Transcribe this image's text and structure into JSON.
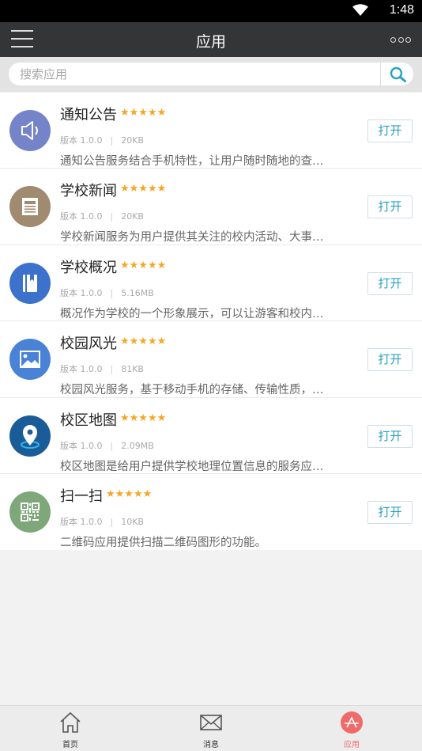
{
  "status_bar": {
    "time": "1:48",
    "wifi_icon": "wifi-icon"
  },
  "app_bar": {
    "title": "应用",
    "menu_icon": "hamburger-menu-icon",
    "more_icon": "more-dots-icon"
  },
  "search": {
    "placeholder": "搜索应用",
    "value": "",
    "icon": "search-icon"
  },
  "apps": [
    {
      "name": "通知公告",
      "rating": 5,
      "version": "版本 1.0.0",
      "size": "20KB",
      "description": "通知公告服务结合手机特性，让用户随时随地的查…",
      "action": "打开",
      "icon": "speaker-icon",
      "icon_color": "#7584c9"
    },
    {
      "name": "学校新闻",
      "rating": 5,
      "version": "版本 1.0.0",
      "size": "20KB",
      "description": "学校新闻服务为用户提供其关注的校内活动、大事…",
      "action": "打开",
      "icon": "newspaper-icon",
      "icon_color": "#a08a70"
    },
    {
      "name": "学校概况",
      "rating": 5,
      "version": "版本 1.0.0",
      "size": "5.16MB",
      "description": "概况作为学校的一个形象展示，可以让游客和校内…",
      "action": "打开",
      "icon": "book-icon",
      "icon_color": "#3c72cc"
    },
    {
      "name": "校园风光",
      "rating": 5,
      "version": "版本 1.0.0",
      "size": "81KB",
      "description": "校园风光服务，基于移动手机的存储、传输性质，…",
      "action": "打开",
      "icon": "picture-icon",
      "icon_color": "#4a82d6"
    },
    {
      "name": "校区地图",
      "rating": 5,
      "version": "版本 1.0.0",
      "size": "2.09MB",
      "description": "校区地图是给用户提供学校地理位置信息的服务应…",
      "action": "打开",
      "icon": "map-pin-icon",
      "icon_color": "#1a5c98"
    },
    {
      "name": "扫一扫",
      "rating": 5,
      "version": "版本 1.0.0",
      "size": "10KB",
      "description": "二维码应用提供扫描二维码图形的功能。",
      "action": "打开",
      "icon": "qr-code-icon",
      "icon_color": "#7ea77a"
    }
  ],
  "bottom_nav": [
    {
      "label": "首页",
      "icon": "home-icon",
      "active": false
    },
    {
      "label": "消息",
      "icon": "envelope-icon",
      "active": false
    },
    {
      "label": "应用",
      "icon": "apps-icon",
      "active": true
    }
  ],
  "colors": {
    "accent": "#2ba0c4",
    "active_tab": "#ef6b6b",
    "star": "#f5a623",
    "app_bar": "#333537"
  }
}
